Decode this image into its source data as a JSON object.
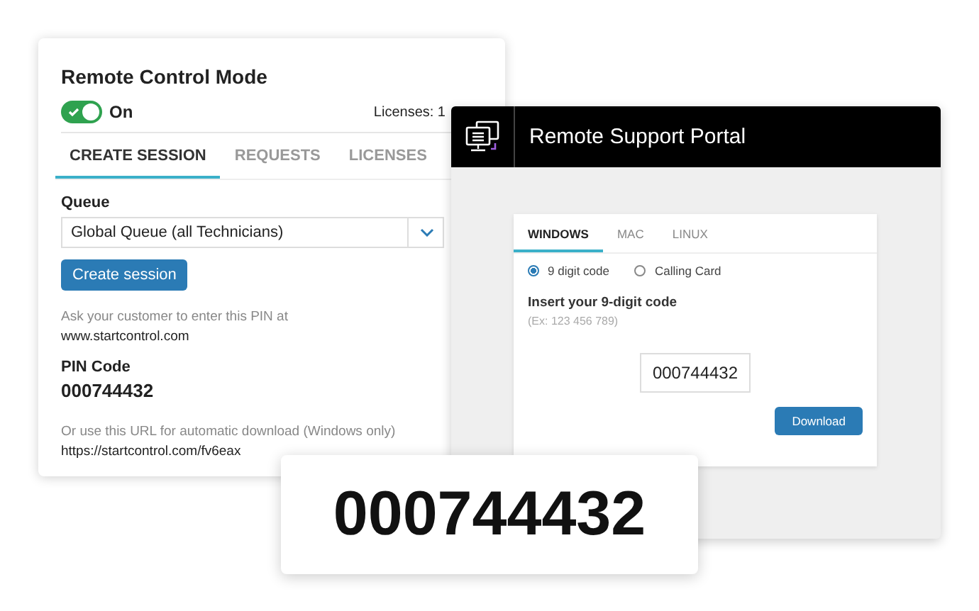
{
  "session_panel": {
    "title": "Remote Control Mode",
    "toggle": {
      "label": "On",
      "on": true
    },
    "licenses": "Licenses: 1",
    "tabs": [
      {
        "label": "CREATE SESSION",
        "selected": true
      },
      {
        "label": "REQUESTS",
        "selected": false
      },
      {
        "label": "LICENSES",
        "selected": false
      }
    ],
    "queue": {
      "label": "Queue",
      "value": "Global Queue (all Technicians)"
    },
    "create_button": "Create session",
    "instruction": "Ask your customer to enter this PIN at",
    "instruction_url": "www.startcontrol.com",
    "pin_label": "PIN Code",
    "pin": "000744432",
    "download_note": "Or use this URL for automatic download (Windows only)",
    "download_url": "https://startcontrol.com/fv6eax"
  },
  "portal": {
    "title": "Remote Support Portal",
    "tabs": [
      {
        "label": "WINDOWS",
        "selected": true
      },
      {
        "label": "MAC",
        "selected": false
      },
      {
        "label": "LINUX",
        "selected": false
      }
    ],
    "options": [
      {
        "label": "9 digit code",
        "selected": true
      },
      {
        "label": "Calling Card",
        "selected": false
      }
    ],
    "code_label": "Insert your 9-digit code",
    "code_hint": "(Ex: 123 456 789)",
    "code_value": "000744432",
    "download_button": "Download"
  },
  "pin_callout": "000744432"
}
